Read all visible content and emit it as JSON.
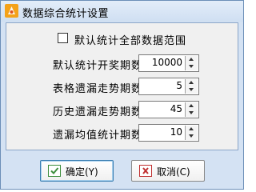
{
  "window": {
    "title": "数据综合统计设置"
  },
  "options": {
    "default_all_range_label": "默认统计全部数据范围",
    "default_all_range_checked": false
  },
  "fields": [
    {
      "label": "默认统计开奖期数",
      "value": "10000"
    },
    {
      "label": "表格遗漏走势期数",
      "value": "5"
    },
    {
      "label": "历史遗漏走势期数",
      "value": "45"
    },
    {
      "label": "遗漏均值统计期数",
      "value": "10"
    }
  ],
  "buttons": {
    "ok_label": "确定(Y)",
    "cancel_label": "取消(C)"
  },
  "icons": {
    "app": "app-logo-icon",
    "ok": "checkmark-icon",
    "cancel": "x-icon"
  },
  "colors": {
    "frame": "#d4e2f3",
    "client": "#f0f0f0",
    "app_icon": "#f4a21a",
    "ok_icon": "#3f8f3f",
    "cancel_icon": "#c03030",
    "default_button_border": "#3c7fb1"
  }
}
